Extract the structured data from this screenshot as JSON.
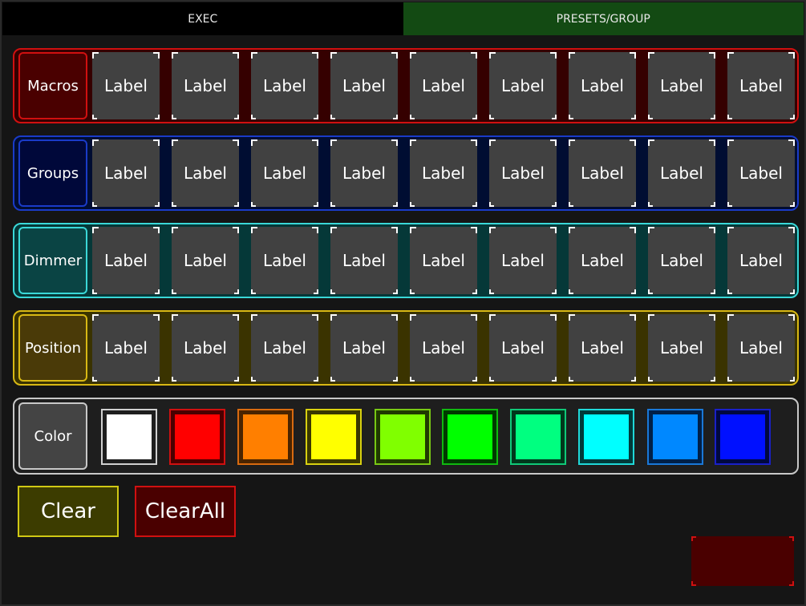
{
  "tabs": [
    {
      "label": "EXEC",
      "active": false
    },
    {
      "label": "PRESETS/GROUP",
      "active": true
    }
  ],
  "rows": [
    {
      "id": "macros",
      "title": "Macros",
      "cells": [
        "Label",
        "Label",
        "Label",
        "Label",
        "Label",
        "Label",
        "Label",
        "Label",
        "Label"
      ]
    },
    {
      "id": "groups",
      "title": "Groups",
      "cells": [
        "Label",
        "Label",
        "Label",
        "Label",
        "Label",
        "Label",
        "Label",
        "Label",
        "Label"
      ]
    },
    {
      "id": "dimmer",
      "title": "Dimmer",
      "cells": [
        "Label",
        "Label",
        "Label",
        "Label",
        "Label",
        "Label",
        "Label",
        "Label",
        "Label"
      ]
    },
    {
      "id": "position",
      "title": "Position",
      "cells": [
        "Label",
        "Label",
        "Label",
        "Label",
        "Label",
        "Label",
        "Label",
        "Label",
        "Label"
      ]
    }
  ],
  "color_row": {
    "title": "Color",
    "swatches": [
      {
        "name": "white",
        "fill": "#ffffff",
        "border": "#d0d0d0",
        "bg": "#1e1e1e"
      },
      {
        "name": "red",
        "fill": "#ff0000",
        "border": "#d01010",
        "bg": "#4a0000"
      },
      {
        "name": "orange",
        "fill": "#ff7f00",
        "border": "#d86a10",
        "bg": "#4a2400"
      },
      {
        "name": "yellow",
        "fill": "#ffff00",
        "border": "#d8d010",
        "bg": "#3a3800"
      },
      {
        "name": "chartreuse",
        "fill": "#80ff00",
        "border": "#78c814",
        "bg": "#203a00"
      },
      {
        "name": "green",
        "fill": "#00ff00",
        "border": "#10b810",
        "bg": "#003a00"
      },
      {
        "name": "spring-green",
        "fill": "#00ff80",
        "border": "#10c878",
        "bg": "#00381c"
      },
      {
        "name": "cyan",
        "fill": "#00ffff",
        "border": "#20d8d8",
        "bg": "#003a3a"
      },
      {
        "name": "azure",
        "fill": "#0088ff",
        "border": "#1a78d8",
        "bg": "#002048"
      },
      {
        "name": "blue",
        "fill": "#0010ff",
        "border": "#1a20c8",
        "bg": "#000840"
      }
    ]
  },
  "buttons": {
    "clear": "Clear",
    "clear_all": "ClearAll"
  }
}
